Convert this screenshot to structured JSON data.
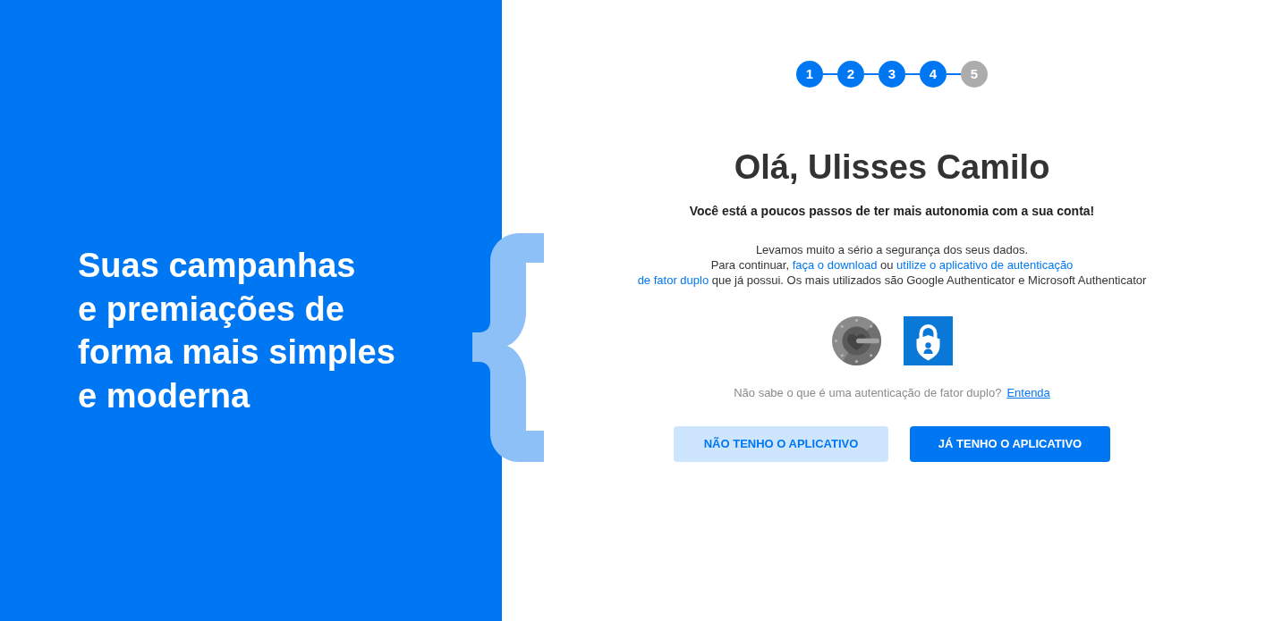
{
  "promo": {
    "lines": [
      "Suas campanhas",
      "e premiações de",
      "forma mais simples",
      "e moderna"
    ]
  },
  "stepper": {
    "steps": [
      {
        "label": "1",
        "done": true
      },
      {
        "label": "2",
        "done": true
      },
      {
        "label": "3",
        "done": true
      },
      {
        "label": "4",
        "done": true
      },
      {
        "label": "5",
        "done": false
      }
    ]
  },
  "greeting": "Olá, Ulisses Camilo",
  "subtitle": "Você está a poucos passos de ter mais autonomia com a sua conta!",
  "security_text": {
    "lines": [
      [
        {
          "text": "Levamos muito a sério a segurança dos seus dados.",
          "kind": "text"
        }
      ],
      [
        {
          "text": "Para continuar, ",
          "kind": "text"
        },
        {
          "text": "faça o download",
          "kind": "link"
        },
        {
          "text": " ou ",
          "kind": "text"
        },
        {
          "text": "utilize o aplicativo de autenticação",
          "kind": "link"
        }
      ],
      [
        {
          "text": "de fator duplo",
          "kind": "link"
        },
        {
          "text": " que já possui. Os mais utilizados são Google Authenticator e Microsoft Authenticator",
          "kind": "text"
        }
      ]
    ]
  },
  "help": {
    "question": "Não sabe o que é uma autenticação de fator duplo?",
    "link": "Entenda"
  },
  "buttons": [
    {
      "label": "NÃO TENHO O APLICATIVO",
      "kind": "secondary"
    },
    {
      "label": "JÁ TENHO O APLICATIVO",
      "kind": "primary"
    }
  ]
}
